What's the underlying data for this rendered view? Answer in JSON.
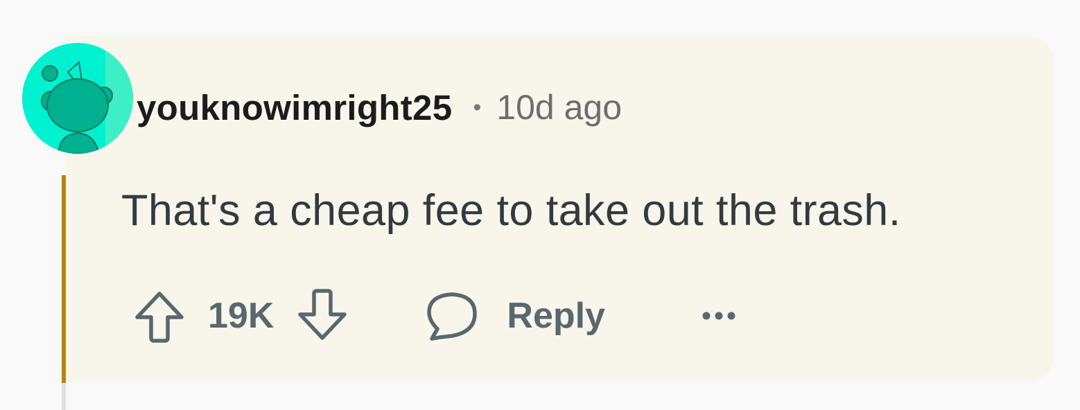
{
  "comment": {
    "author": "youknowimright25",
    "separator": "•",
    "timestamp": "10d ago",
    "body": "That's a cheap fee to take out the trash.",
    "score": "19K",
    "reply_label": "Reply",
    "more_label": "•••"
  },
  "colors": {
    "card_background": "#f8f6ea",
    "thread_accent": "#b8860b",
    "avatar_background": "#00f1cf",
    "action_text": "#59676e"
  },
  "icons": {
    "avatar": "snoo-avatar-icon",
    "upvote": "upvote-arrow-icon",
    "downvote": "downvote-arrow-icon",
    "reply": "comment-bubble-icon",
    "more": "ellipsis-icon"
  }
}
